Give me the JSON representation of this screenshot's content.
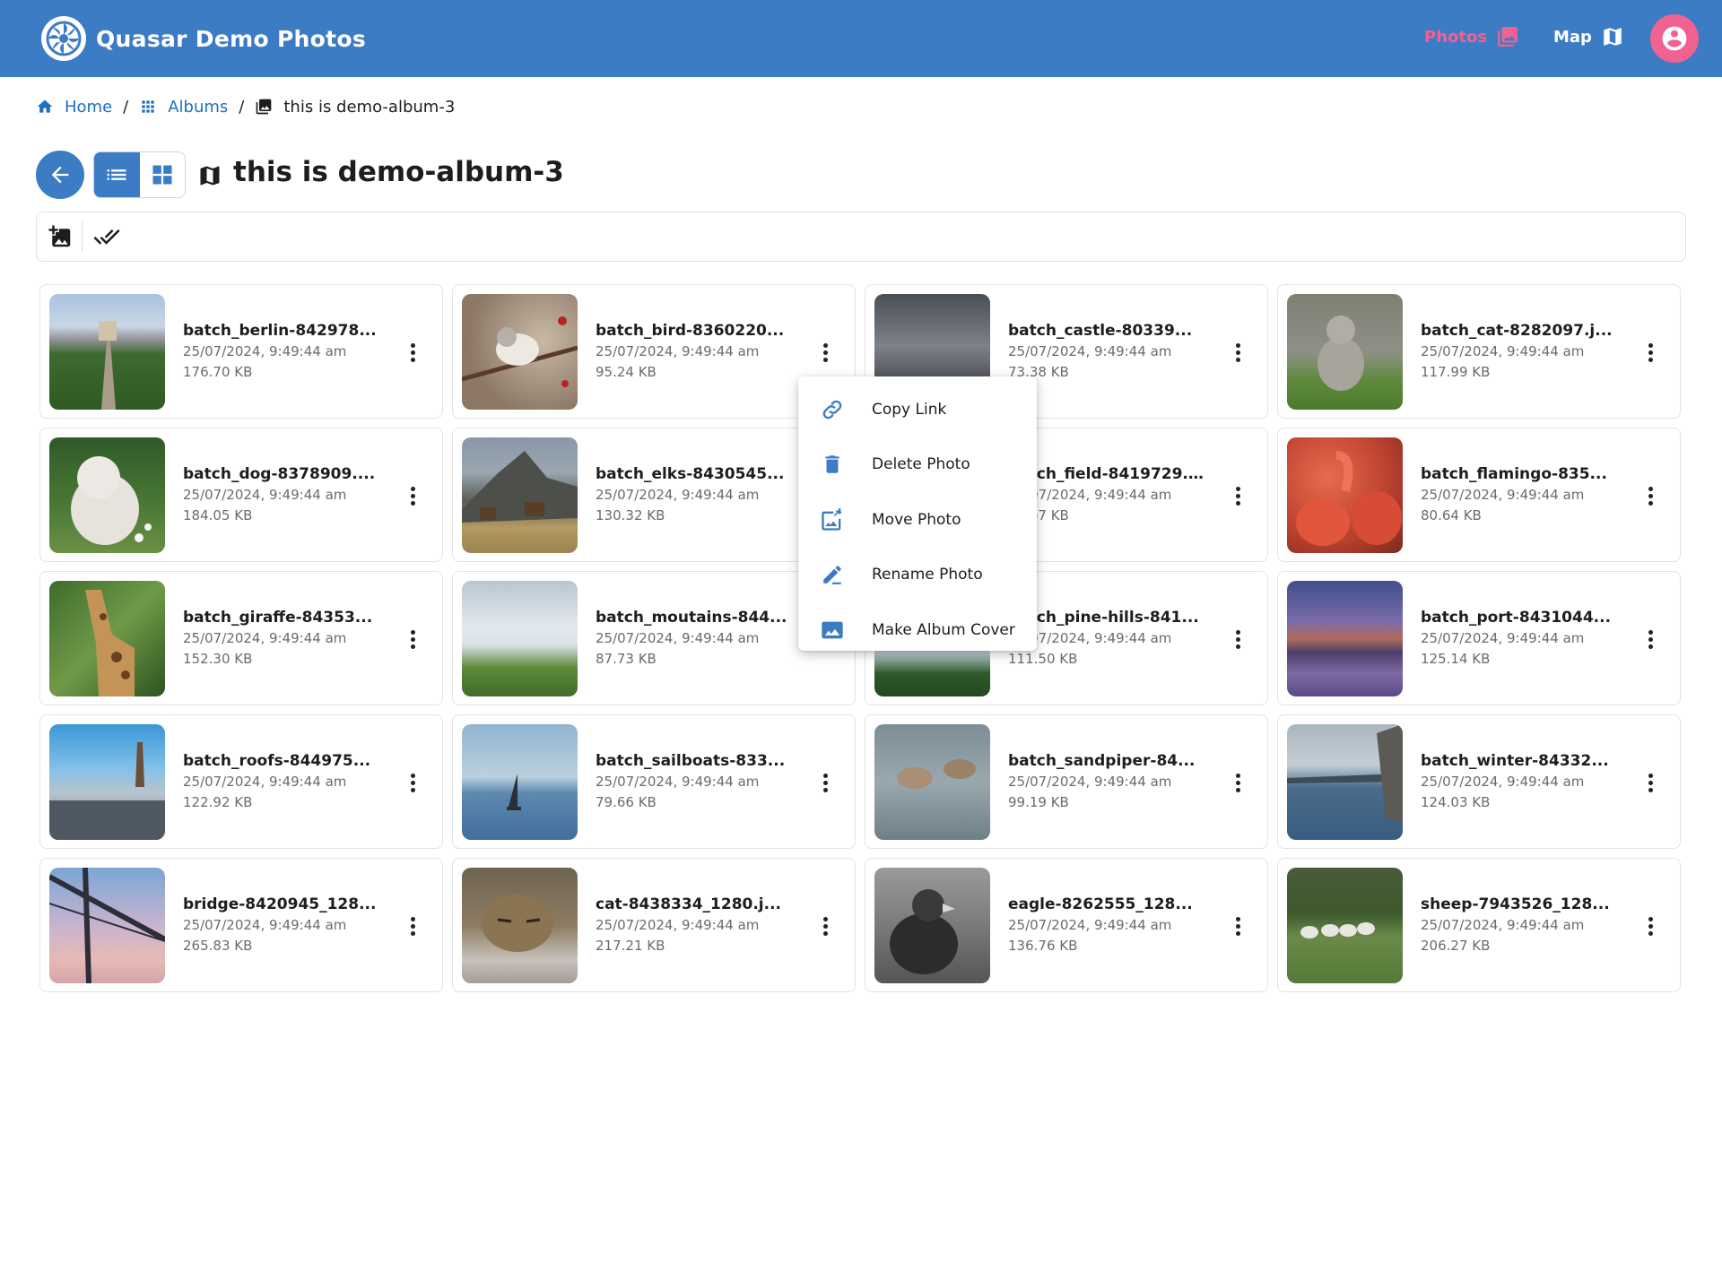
{
  "app": {
    "title": "Quasar Demo Photos"
  },
  "nav": {
    "photos": "Photos",
    "map": "Map"
  },
  "breadcrumb": {
    "home": "Home",
    "albums": "Albums",
    "current": "this is demo-album-3"
  },
  "album": {
    "title": "this is demo-album-3"
  },
  "colors": {
    "primary": "#3b7cc4",
    "accent": "#f06292",
    "link": "#1d6fbf"
  },
  "menu": {
    "items": [
      {
        "label": "Copy Link",
        "icon": "link-icon"
      },
      {
        "label": "Delete Photo",
        "icon": "trash-icon"
      },
      {
        "label": "Move Photo",
        "icon": "move-photo-icon"
      },
      {
        "label": "Rename Photo",
        "icon": "pencil-icon"
      },
      {
        "label": "Make Album Cover",
        "icon": "image-icon"
      }
    ]
  },
  "photos": [
    {
      "name": "batch_berlin-842978...",
      "date": "25/07/2024, 9:49:44 am",
      "size": "176.70 KB"
    },
    {
      "name": "batch_bird-8360220...",
      "date": "25/07/2024, 9:49:44 am",
      "size": "95.24 KB"
    },
    {
      "name": "batch_castle-80339...",
      "date": "25/07/2024, 9:49:44 am",
      "size": "73.38 KB"
    },
    {
      "name": "batch_cat-8282097.j...",
      "date": "25/07/2024, 9:49:44 am",
      "size": "117.99 KB"
    },
    {
      "name": "batch_dog-8378909....",
      "date": "25/07/2024, 9:49:44 am",
      "size": "184.05 KB"
    },
    {
      "name": "batch_elks-8430545...",
      "date": "25/07/2024, 9:49:44 am",
      "size": "130.32 KB"
    },
    {
      "name": "batch_field-8419729....",
      "date": "25/07/2024, 9:49:44 am",
      "size": "96.67 KB"
    },
    {
      "name": "batch_flamingo-835...",
      "date": "25/07/2024, 9:49:44 am",
      "size": "80.64 KB"
    },
    {
      "name": "batch_giraffe-84353...",
      "date": "25/07/2024, 9:49:44 am",
      "size": "152.30 KB"
    },
    {
      "name": "batch_moutains-844...",
      "date": "25/07/2024, 9:49:44 am",
      "size": "87.73 KB"
    },
    {
      "name": "batch_pine-hills-841...",
      "date": "25/07/2024, 9:49:44 am",
      "size": "111.50 KB"
    },
    {
      "name": "batch_port-8431044...",
      "date": "25/07/2024, 9:49:44 am",
      "size": "125.14 KB"
    },
    {
      "name": "batch_roofs-844975...",
      "date": "25/07/2024, 9:49:44 am",
      "size": "122.92 KB"
    },
    {
      "name": "batch_sailboats-833...",
      "date": "25/07/2024, 9:49:44 am",
      "size": "79.66 KB"
    },
    {
      "name": "batch_sandpiper-84...",
      "date": "25/07/2024, 9:49:44 am",
      "size": "99.19 KB"
    },
    {
      "name": "batch_winter-84332...",
      "date": "25/07/2024, 9:49:44 am",
      "size": "124.03 KB"
    },
    {
      "name": "bridge-8420945_128...",
      "date": "25/07/2024, 9:49:44 am",
      "size": "265.83 KB"
    },
    {
      "name": "cat-8438334_1280.j...",
      "date": "25/07/2024, 9:49:44 am",
      "size": "217.21 KB"
    },
    {
      "name": "eagle-8262555_128...",
      "date": "25/07/2024, 9:49:44 am",
      "size": "136.76 KB"
    },
    {
      "name": "sheep-7943526_128...",
      "date": "25/07/2024, 9:49:44 am",
      "size": "206.27 KB"
    }
  ]
}
